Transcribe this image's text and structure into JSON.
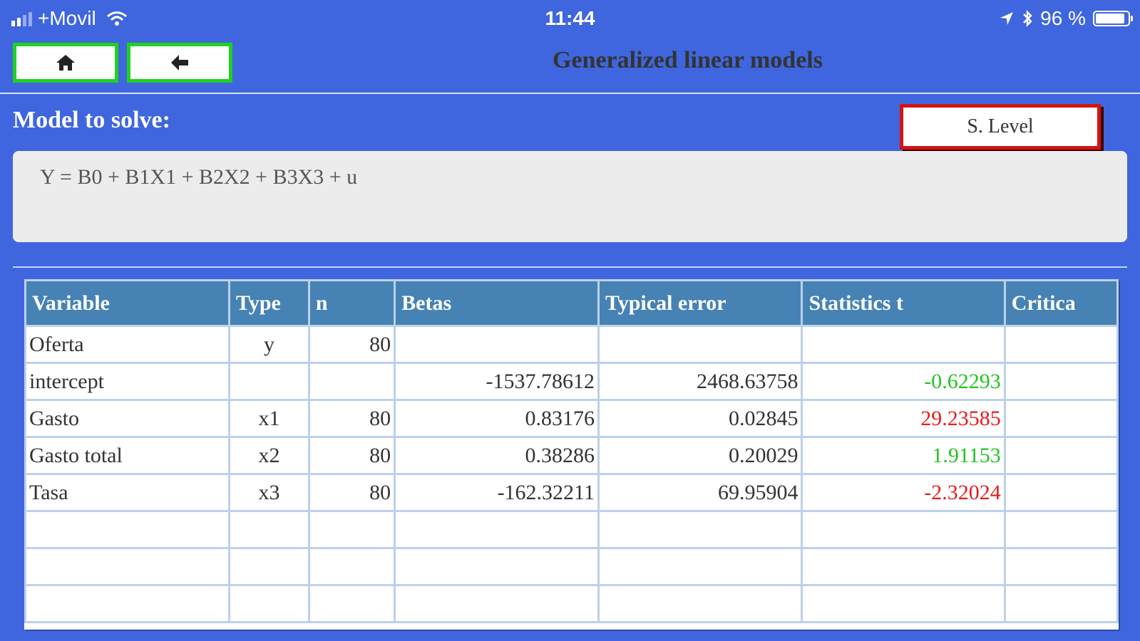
{
  "status": {
    "carrier": "+Movil",
    "time": "11:44",
    "battery": "96 %"
  },
  "nav": {
    "home_icon": "home-icon",
    "back_icon": "arrow-left-icon",
    "title": "Generalized linear models"
  },
  "model": {
    "label": "Model to solve:",
    "s_level_button": "S. Level",
    "formula": "Y = B0 + B1X1 + B2X2 + B3X3 + u"
  },
  "colors": {
    "background": "#3f66de",
    "header": "#4682b4",
    "nav_border": "#1fd21f",
    "slevel_border": "#d21414",
    "positive": "#22c422",
    "negative": "#e81c1c"
  },
  "table": {
    "headers": [
      "Variable",
      "Type",
      "n",
      "Betas",
      "Typical error",
      "Statistics t",
      "Critica"
    ],
    "rows": [
      {
        "variable": "Oferta",
        "type": "y",
        "n": "80",
        "beta": "",
        "error": "",
        "t": "",
        "t_color": "",
        "critical": ""
      },
      {
        "variable": "intercept",
        "type": "",
        "n": "",
        "beta": "-1537.78612",
        "error": "2468.63758",
        "t": "-0.62293",
        "t_color": "pos",
        "critical": ""
      },
      {
        "variable": "Gasto",
        "type": "x1",
        "n": "80",
        "beta": "0.83176",
        "error": "0.02845",
        "t": "29.23585",
        "t_color": "neg",
        "critical": ""
      },
      {
        "variable": "Gasto total",
        "type": "x2",
        "n": "80",
        "beta": "0.38286",
        "error": "0.20029",
        "t": "1.91153",
        "t_color": "pos",
        "critical": ""
      },
      {
        "variable": "Tasa",
        "type": "x3",
        "n": "80",
        "beta": "-162.32211",
        "error": "69.95904",
        "t": "-2.32024",
        "t_color": "neg",
        "critical": ""
      },
      {
        "variable": "",
        "type": "",
        "n": "",
        "beta": "",
        "error": "",
        "t": "",
        "t_color": "",
        "critical": ""
      },
      {
        "variable": "",
        "type": "",
        "n": "",
        "beta": "",
        "error": "",
        "t": "",
        "t_color": "",
        "critical": ""
      },
      {
        "variable": "",
        "type": "",
        "n": "",
        "beta": "",
        "error": "",
        "t": "",
        "t_color": "",
        "critical": ""
      }
    ]
  }
}
